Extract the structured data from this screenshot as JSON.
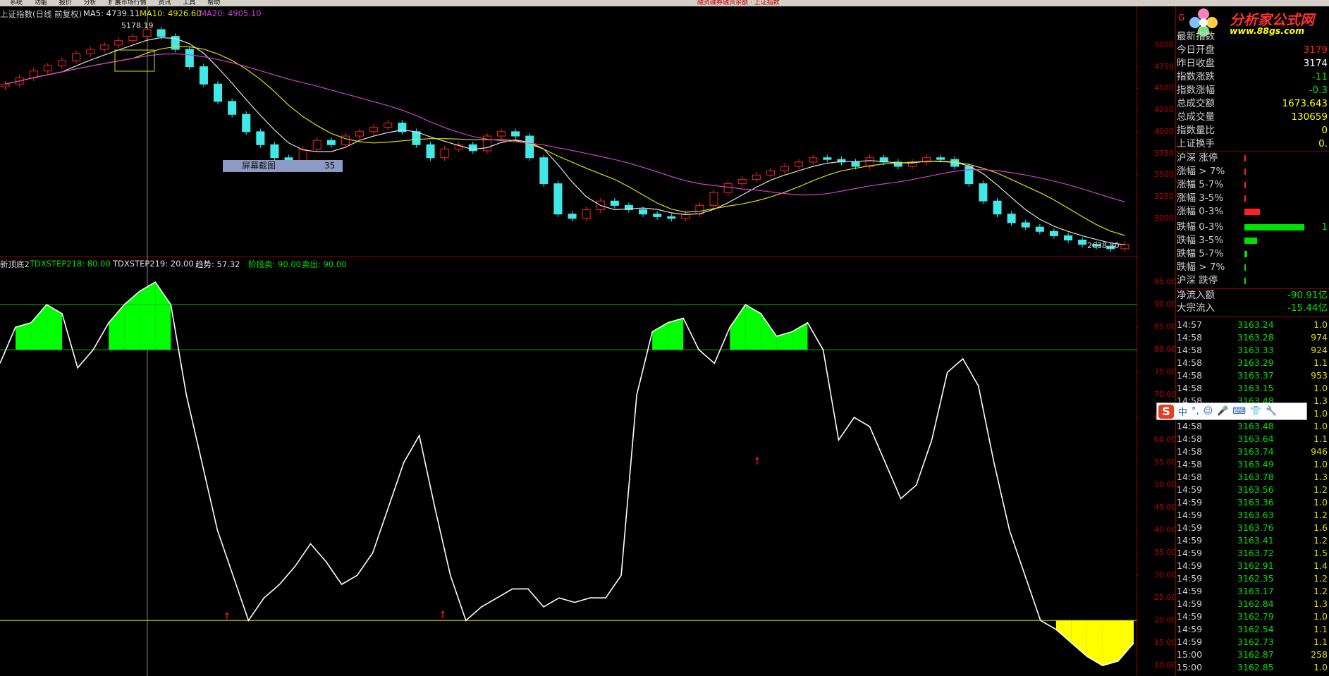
{
  "menu": {
    "items": [
      "系统",
      "功能",
      "报价",
      "分析",
      "扩展市场行情",
      "资讯",
      "工具",
      "帮助"
    ],
    "center_text": "融资融券融资余额 · 上证指数"
  },
  "main_header": {
    "title": "上证指数(日线 前复权)",
    "ma5": "MA5: 4739.11",
    "ma10": "MA10: 4926.60",
    "ma20": "MA20: 4905.10"
  },
  "annotations": {
    "high": "5178.19",
    "low": "2638.30",
    "tooltip_label": "屏幕截图",
    "tooltip_value": "35"
  },
  "sub_header": {
    "name": "新顶底2",
    "step218": "TDXSTEP218: 80.00",
    "step219": "TDXSTEP219: 20.00",
    "trend": "趋势: 57.32",
    "stage_sell": "阶段卖: 90.00",
    "sell": "卖出: 90.00"
  },
  "colors": {
    "up": "#ff2020",
    "down": "#40e8e8",
    "ma5": "#e0e0e0",
    "ma10": "#e0e000",
    "ma20": "#d040d0",
    "green_fill": "#00ff00",
    "yellow_fill": "#ffff00",
    "grid_red": "#900000"
  },
  "price_axis": [
    "5000",
    "4750",
    "4500",
    "4250",
    "4000",
    "3750",
    "3500",
    "3250",
    "3000"
  ],
  "ind_axis": [
    "95.00",
    "90.00",
    "85.00",
    "80.00",
    "75.00",
    "70.00",
    "65.00",
    "60.00",
    "55.00",
    "50.00",
    "45.00",
    "40.00",
    "35.00",
    "30.00",
    "25.00",
    "20.00",
    "15.00",
    "10.00"
  ],
  "logo": {
    "title": "分析家公式网",
    "url": "www.88gs.com"
  },
  "sidebar_top": {
    "label": "G"
  },
  "quote_rows": [
    {
      "label": "最新指数",
      "value": "",
      "color": "#ff2020"
    },
    {
      "label": "今日开盘",
      "value": "3179",
      "color": "#ff2020"
    },
    {
      "label": "昨日收盘",
      "value": "3174",
      "color": "#ffffff"
    },
    {
      "label": "指数涨跌",
      "value": "-11",
      "color": "#00e000"
    },
    {
      "label": "指数涨幅",
      "value": "-0.3",
      "color": "#00e000"
    },
    {
      "label": "总成交额",
      "value": "1673.643",
      "color": "#ffff00"
    },
    {
      "label": "总成交量",
      "value": "130659",
      "color": "#ffff00"
    },
    {
      "label": "指数量比",
      "value": "0",
      "color": "#ffff00"
    },
    {
      "label": "上证换手",
      "value": "0.",
      "color": "#ffff00"
    }
  ],
  "breadth_rows": [
    {
      "label": "沪深 涨停",
      "bar": 0.0,
      "color": "#ff2020",
      "num": ""
    },
    {
      "label": "涨幅 > 7%",
      "bar": 0.0,
      "color": "#ff2020",
      "num": ""
    },
    {
      "label": "涨幅 5-7%",
      "bar": 0.0,
      "color": "#ff2020",
      "num": ""
    },
    {
      "label": "涨幅 3-5%",
      "bar": 0.02,
      "color": "#ff2020",
      "num": ""
    },
    {
      "label": "涨幅 0-3%",
      "bar": 0.22,
      "color": "#ff2020",
      "num": ""
    },
    {
      "label": "跌幅 0-3%",
      "bar": 0.85,
      "color": "#00e000",
      "num": "1"
    },
    {
      "label": "跌幅 3-5%",
      "bar": 0.18,
      "color": "#00e000",
      "num": ""
    },
    {
      "label": "跌幅 5-7%",
      "bar": 0.04,
      "color": "#00e000",
      "num": ""
    },
    {
      "label": "跌幅 > 7%",
      "bar": 0.0,
      "color": "#00e000",
      "num": ""
    },
    {
      "label": "沪深 跌停",
      "bar": 0.0,
      "color": "#00e000",
      "num": ""
    }
  ],
  "flow_rows": [
    {
      "label": "净流入额",
      "value": "-90.91亿",
      "color": "#00e000"
    },
    {
      "label": "大宗流入",
      "value": "-15.44亿",
      "color": "#00e000"
    }
  ],
  "ticks": [
    {
      "t": "14:57",
      "p": "3163.24",
      "v": "1.0"
    },
    {
      "t": "14:58",
      "p": "3163.28",
      "v": "974"
    },
    {
      "t": "14:58",
      "p": "3163.33",
      "v": "924"
    },
    {
      "t": "14:58",
      "p": "3163.29",
      "v": "1.1"
    },
    {
      "t": "14:58",
      "p": "3163.37",
      "v": "953"
    },
    {
      "t": "14:58",
      "p": "3163.15",
      "v": "1.0"
    },
    {
      "t": "14:58",
      "p": "3163.48",
      "v": "1.3"
    },
    {
      "t": "14:58",
      "p": "3163.53",
      "v": "1.0"
    },
    {
      "t": "14:58",
      "p": "3163.48",
      "v": "1.0"
    },
    {
      "t": "14:58",
      "p": "3163.64",
      "v": "1.1"
    },
    {
      "t": "14:58",
      "p": "3163.74",
      "v": "946"
    },
    {
      "t": "14:58",
      "p": "3163.49",
      "v": "1.0"
    },
    {
      "t": "14:58",
      "p": "3163.78",
      "v": "1.3"
    },
    {
      "t": "14:59",
      "p": "3163.56",
      "v": "1.2"
    },
    {
      "t": "14:59",
      "p": "3163.36",
      "v": "1.0"
    },
    {
      "t": "14:59",
      "p": "3163.63",
      "v": "1.2"
    },
    {
      "t": "14:59",
      "p": "3163.76",
      "v": "1.6"
    },
    {
      "t": "14:59",
      "p": "3163.41",
      "v": "1.2"
    },
    {
      "t": "14:59",
      "p": "3163.72",
      "v": "1.5"
    },
    {
      "t": "14:59",
      "p": "3162.91",
      "v": "1.4"
    },
    {
      "t": "14:59",
      "p": "3162.35",
      "v": "1.2"
    },
    {
      "t": "14:59",
      "p": "3163.17",
      "v": "1.2"
    },
    {
      "t": "14:59",
      "p": "3162.84",
      "v": "1.3"
    },
    {
      "t": "14:59",
      "p": "3162.79",
      "v": "1.0"
    },
    {
      "t": "14:59",
      "p": "3162.54",
      "v": "1.1"
    },
    {
      "t": "14:59",
      "p": "3162.73",
      "v": "1.1"
    },
    {
      "t": "15:00",
      "p": "3162.87",
      "v": "258"
    },
    {
      "t": "15:00",
      "p": "3162.85",
      "v": "1.0"
    }
  ],
  "ime": {
    "items": [
      "中",
      "°,",
      "☺",
      "🎤",
      "⌨",
      "👕",
      "🔧"
    ]
  },
  "chart_data": {
    "type": "candlestick",
    "price_series": [
      4550,
      4620,
      4700,
      4760,
      4820,
      4900,
      4950,
      5000,
      5050,
      5100,
      5178,
      5100,
      4950,
      4750,
      4550,
      4350,
      4200,
      4000,
      3850,
      3700,
      3600,
      3800,
      3900,
      3850,
      3950,
      4000,
      4050,
      4100,
      4000,
      3850,
      3700,
      3800,
      3850,
      3780,
      3950,
      4000,
      3950,
      3700,
      3400,
      3050,
      3000,
      3100,
      3200,
      3150,
      3100,
      3050,
      3020,
      3000,
      3050,
      3150,
      3300,
      3400,
      3450,
      3500,
      3550,
      3600,
      3650,
      3700,
      3680,
      3650,
      3600,
      3700,
      3650,
      3600,
      3650,
      3700,
      3680,
      3600,
      3400,
      3200,
      3050,
      2950,
      2900,
      2850,
      2800,
      2750,
      2700,
      2680,
      2650,
      2700
    ],
    "indicator": [
      77,
      85,
      86,
      90,
      88,
      76,
      80,
      86,
      90,
      93,
      95,
      90,
      70,
      55,
      40,
      30,
      20,
      25,
      28,
      32,
      37,
      33,
      28,
      30,
      35,
      45,
      55,
      61,
      45,
      30,
      20,
      23,
      25,
      27,
      27,
      23,
      25,
      24,
      25,
      25,
      30,
      70,
      84,
      86,
      87,
      80,
      77,
      85,
      90,
      88,
      83,
      84,
      86,
      80,
      60,
      65,
      63,
      55,
      47,
      50,
      60,
      75,
      78,
      72,
      55,
      40,
      30,
      20,
      18,
      15,
      12,
      10,
      11,
      15
    ],
    "ref_lines": [
      90,
      80,
      20
    ],
    "ylim_price": [
      2600,
      5300
    ],
    "ylim_indicator": [
      8,
      98
    ]
  }
}
